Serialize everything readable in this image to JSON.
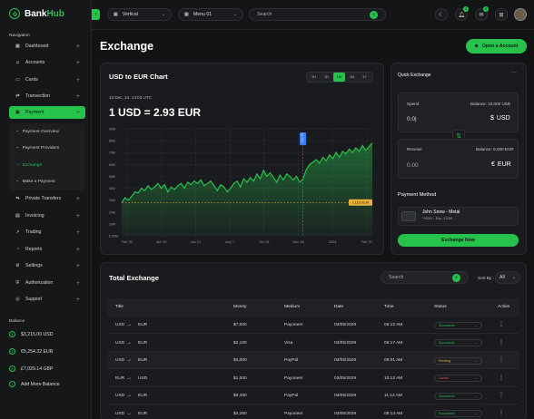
{
  "brand": {
    "name_a": "Bank",
    "name_b": "Hub"
  },
  "sidebar": {
    "nav_title": "Navigation",
    "items": [
      {
        "label": "Dashboard",
        "icon": "grid-icon"
      },
      {
        "label": "Accounts",
        "icon": "user-icon"
      },
      {
        "label": "Cards",
        "icon": "card-icon"
      },
      {
        "label": "Transection",
        "icon": "swap-icon"
      },
      {
        "label": "Payment",
        "icon": "wallet-icon"
      },
      {
        "label": "Private Transfers",
        "icon": "transfer-icon"
      },
      {
        "label": "Invoicing",
        "icon": "invoice-icon"
      },
      {
        "label": "Trading",
        "icon": "trading-icon"
      },
      {
        "label": "Reports",
        "icon": "report-icon"
      },
      {
        "label": "Settings",
        "icon": "gear-icon"
      },
      {
        "label": "Authorization",
        "icon": "shield-icon"
      },
      {
        "label": "Support",
        "icon": "support-icon"
      }
    ],
    "sub_items": [
      "Payment Overview",
      "Payment Providers",
      "Exchange",
      "Make a Payment"
    ],
    "balance_title": "Balance",
    "balances": [
      "$3,215.00 USD",
      "€5,254.32 EUR",
      "£7,029.14 GBP"
    ],
    "add_balance": "Add More Balance"
  },
  "topbar": {
    "select1": "Vertical",
    "select2": "Menu 01",
    "search_placeholder": "Search",
    "badge1": "3",
    "badge2": "3"
  },
  "page": {
    "title": "Exchange",
    "open_account": "Open a Account"
  },
  "chart_card": {
    "title": "USD to EUR Chart",
    "ranges": [
      "1H",
      "1D",
      "1W",
      "1M",
      "1Y"
    ],
    "active_range": "1W",
    "date": "12 Dec, 24. 14:03 UTC",
    "rate": "1 USD = 2.93 EUR",
    "marker_label": "Nov 25",
    "price_tag": "1.1123 EUR"
  },
  "chart_data": {
    "type": "area",
    "x_labels": [
      "Feb '23",
      "Apr '20",
      "Jun '21",
      "Aug '7",
      "Oct '04",
      "Nov '25",
      "2024",
      "Feb '07"
    ],
    "y_ticks": [
      "0.00M",
      "10M",
      "20M",
      "30M",
      "40M",
      "50M",
      "60M",
      "70M",
      "80M",
      "90M"
    ],
    "ylim": [
      0,
      90
    ],
    "grid": true,
    "color": "#27c24c",
    "values": [
      28,
      32,
      30,
      33,
      37,
      36,
      40,
      38,
      42,
      39,
      41,
      44,
      40,
      43,
      37,
      41,
      39,
      42,
      44,
      40,
      45,
      43,
      46,
      44,
      47,
      42,
      44,
      46,
      42,
      38,
      43,
      41,
      37,
      40,
      44,
      46,
      41,
      48,
      45,
      49,
      46,
      52,
      48,
      55,
      50,
      53,
      49,
      45,
      51,
      47,
      52,
      50,
      47,
      50,
      45,
      48,
      56,
      60,
      62,
      64,
      61,
      66,
      63,
      68,
      65,
      70,
      66,
      71,
      69,
      73,
      70,
      74,
      71,
      76,
      72,
      75,
      78
    ]
  },
  "quick": {
    "title": "Quick Exchange",
    "spend_label": "Spend",
    "spend_balance": "Balance: 10,000 USD",
    "spend_value": "0.0|",
    "spend_cur": "USD",
    "spend_sym": "$",
    "receive_label": "Receive",
    "receive_balance": "Balance: 6,000 EUR",
    "receive_value": "0.00",
    "receive_cur": "EUR",
    "receive_sym": "€",
    "method_title": "Payment Method",
    "card_name": "John Snow - Metal",
    "card_sub": "**4291 - Exp. 12/26",
    "button": "Exchange Now"
  },
  "table": {
    "title": "Total Exchange",
    "search_placeholder": "Search",
    "sort_label": "Sort By :",
    "sort_value": "All",
    "headers": [
      "Title",
      "Money",
      "Medium",
      "Date",
      "Time",
      "Status",
      "Action"
    ],
    "rows": [
      {
        "from": "USD",
        "to": "EUR",
        "money": "$7,000",
        "medium": "Payoneer",
        "date": "03/05/2029",
        "time": "05:12 AM",
        "status": "Successful",
        "status_color": "#27c24c"
      },
      {
        "from": "USD",
        "to": "EUR",
        "money": "$2,100",
        "medium": "Visa",
        "date": "03/05/2029",
        "time": "06:17 AM",
        "status": "Successful",
        "status_color": "#27c24c"
      },
      {
        "from": "USD",
        "to": "EUR",
        "money": "$4,000",
        "medium": "PayPal",
        "date": "03/05/2029",
        "time": "09:01 AM",
        "status": "Pending",
        "status_color": "#e8b23a"
      },
      {
        "from": "EUR",
        "to": "USD",
        "money": "$1,000",
        "medium": "Payoneer",
        "date": "03/05/2029",
        "time": "10:12 AM",
        "status": "Cancel",
        "status_color": "#e5484d"
      },
      {
        "from": "USD",
        "to": "EUR",
        "money": "$9,450",
        "medium": "PayPal",
        "date": "03/05/2029",
        "time": "11:12 AM",
        "status": "Successful",
        "status_color": "#27c24c"
      },
      {
        "from": "USD",
        "to": "EUR",
        "money": "$3,250",
        "medium": "Payoneer",
        "date": "03/05/2029",
        "time": "08:13 AM",
        "status": "Successful",
        "status_color": "#27c24c"
      }
    ]
  }
}
